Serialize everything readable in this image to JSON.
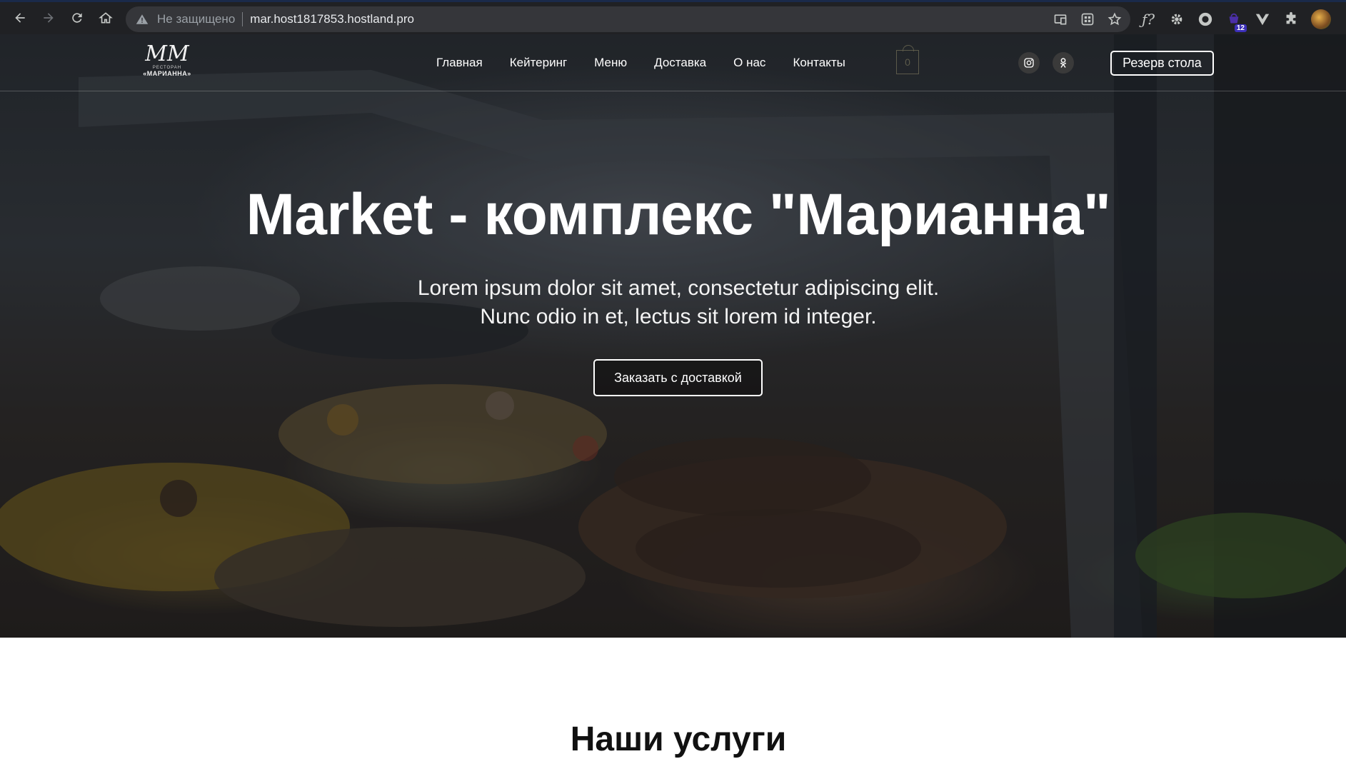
{
  "browser": {
    "insecure_label": "Не защищено",
    "url": "mar.host1817853.hostland.pro",
    "extension_badge": "12"
  },
  "site": {
    "logo": {
      "monogram": "MM",
      "small_text": "РЕСТОРАН",
      "name": "«МАРИАННА»"
    },
    "nav": [
      {
        "label": "Главная"
      },
      {
        "label": "Кейтеринг"
      },
      {
        "label": "Меню"
      },
      {
        "label": "Доставка"
      },
      {
        "label": "О нас"
      },
      {
        "label": "Контакты"
      }
    ],
    "cart_count": "0",
    "reserve_label": "Резерв стола",
    "social": [
      "instagram-icon",
      "odnoklassniki-icon"
    ]
  },
  "hero": {
    "title": "Market - комплекс \"Марианна\"",
    "subtitle_line1": "Lorem ipsum dolor sit amet, consectetur adipiscing elit.",
    "subtitle_line2": "Nunc odio in et, lectus sit lorem id integer.",
    "order_label": "Заказать с доставкой"
  },
  "services": {
    "title": "Наши услуги"
  }
}
